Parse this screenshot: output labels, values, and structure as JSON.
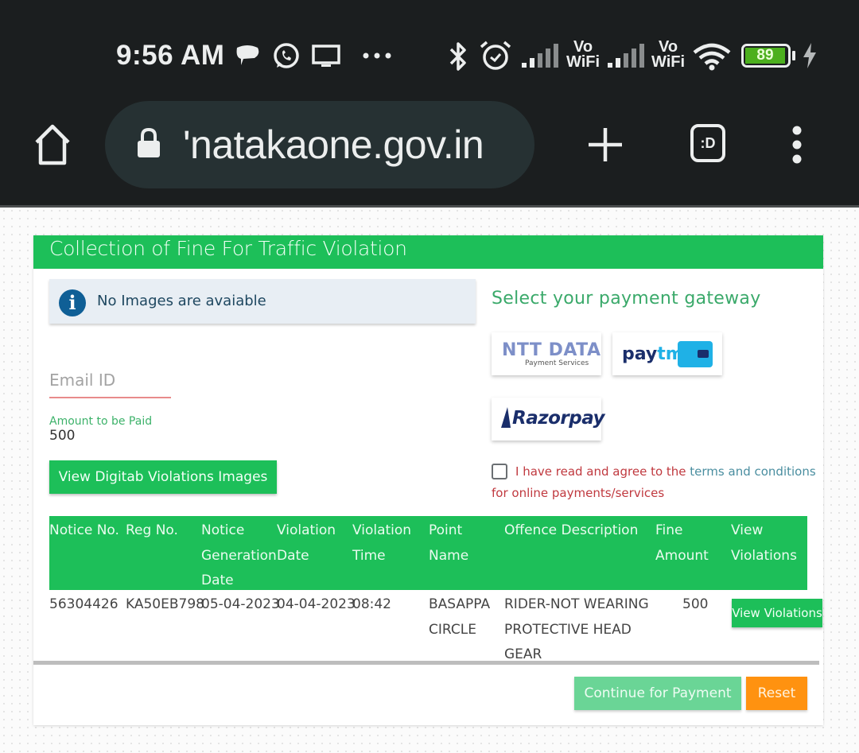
{
  "status_bar": {
    "time": "9:56 AM",
    "left_icons": [
      "chat-bubble-icon",
      "whatsapp-icon",
      "cast-screen-icon",
      "more-dots-icon"
    ],
    "right_icons": [
      "bluetooth-icon",
      "alarm-icon",
      "signal-icon",
      "vowifi-icon",
      "signal-icon",
      "vowifi-icon",
      "wifi-icon",
      "battery-icon",
      "charging-icon"
    ],
    "vowifi_label_top": "Vo",
    "vowifi_label_bottom": "WiFi",
    "battery_level": "89",
    "battery_color": "#4caf1e"
  },
  "browser": {
    "url": "'natakaone.gov.in",
    "icons": [
      "home-icon",
      "lock-icon",
      "new-tab-plus-icon",
      "tab-switcher-icon",
      "overflow-menu-icon"
    ],
    "tab_switcher_label": ":D"
  },
  "page": {
    "title": "Collection of Fine For Traffic Violation",
    "alert_text": "No Images are avaiable",
    "email_placeholder": "Email ID",
    "amount_label": "Amount to be Paid",
    "amount_value": "500",
    "view_images_button": "View Digitab Violations Images",
    "gateway_title": "Select your payment gateway",
    "gateways": [
      {
        "name": "NTT DATA",
        "subtitle": "Payment Services"
      },
      {
        "name_part1": "pay",
        "name_part2": "tm"
      },
      {
        "name": "Razorpay"
      }
    ],
    "terms": {
      "prefix": "I have read and agree to the ",
      "link": "terms and conditions",
      "suffix": "for online payments/services"
    },
    "table": {
      "headers": [
        "Notice No.",
        "Reg No.",
        "Notice\nGeneration\nDate",
        "Violation\nDate",
        "Violation\nTime",
        "Point\nName",
        "Offence Description",
        "Fine\nAmount",
        "View\nViolations"
      ],
      "rows": [
        {
          "notice_no": "56304426",
          "reg_no": "KA50EB798",
          "notice_generation_date": "05-04-2023",
          "violation_date": "04-04-2023",
          "violation_time": "08:42",
          "point_name": "BASAPPA\nCIRCLE",
          "offence_description": "RIDER-NOT WEARING\nPROTECTIVE HEAD\nGEAR",
          "fine_amount": "500",
          "view_button": "View Violations"
        }
      ]
    },
    "continue_button": "Continue for Payment",
    "reset_button": "Reset",
    "colors": {
      "primary_green": "#1dbf59",
      "disabled_green": "#6ad596",
      "reset_orange": "#ff9210",
      "terms_red": "#c0393f",
      "link_teal": "#4a8ea0"
    }
  }
}
